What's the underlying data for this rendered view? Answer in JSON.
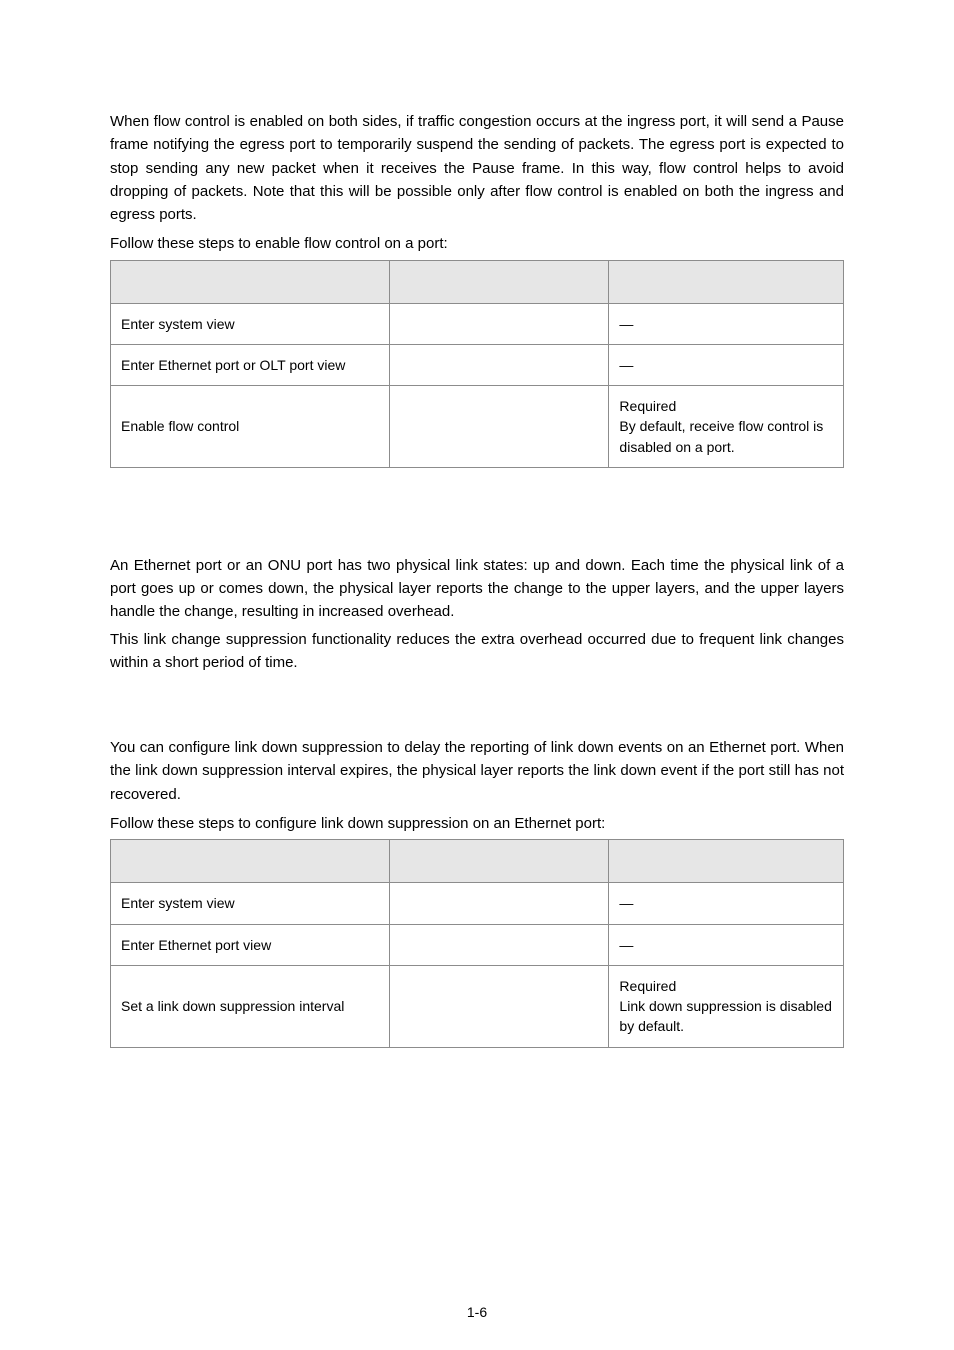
{
  "intro": {
    "p1": "When flow control is enabled on both sides, if traffic congestion occurs at the ingress port, it will send a Pause frame notifying the egress port to temporarily suspend the sending of packets. The egress port is expected to stop sending any new packet when it receives the Pause frame. In this way, flow control helps to avoid dropping of packets. Note that this will be possible only after flow control is enabled on both the ingress and egress ports.",
    "p2": "Follow these steps to enable flow control on a port:"
  },
  "table1": {
    "rows": [
      {
        "c1": "Enter system view",
        "c2": "",
        "c3": "—"
      },
      {
        "c1": "Enter Ethernet port or OLT port view",
        "c2": "",
        "c3": "—"
      },
      {
        "c1": "Enable flow control",
        "c2": "",
        "c3": "Required\nBy default, receive flow control is disabled on a port."
      }
    ]
  },
  "section2": {
    "p1": "An Ethernet port or an ONU port has two physical link states: up and down. Each time the physical link of a port goes up or comes down, the physical layer reports the change to the upper layers, and the upper layers handle the change, resulting in increased overhead.",
    "p2": "This link change suppression functionality reduces the extra overhead occurred due to frequent link changes within a short period of time."
  },
  "section3": {
    "p1": "You can configure link down suppression to delay the reporting of link down events on an Ethernet port. When the link down suppression interval expires, the physical layer reports the link down event if the port still has not recovered.",
    "p2": "Follow these steps to configure link down suppression on an Ethernet port:"
  },
  "table2": {
    "rows": [
      {
        "c1": "Enter system view",
        "c2": "",
        "c3": "—"
      },
      {
        "c1": "Enter Ethernet port view",
        "c2": "",
        "c3": "—"
      },
      {
        "c1": "Set a link down suppression interval",
        "c2": "",
        "c3": "Required\nLink down suppression is disabled by default."
      }
    ]
  },
  "footer": "1-6"
}
